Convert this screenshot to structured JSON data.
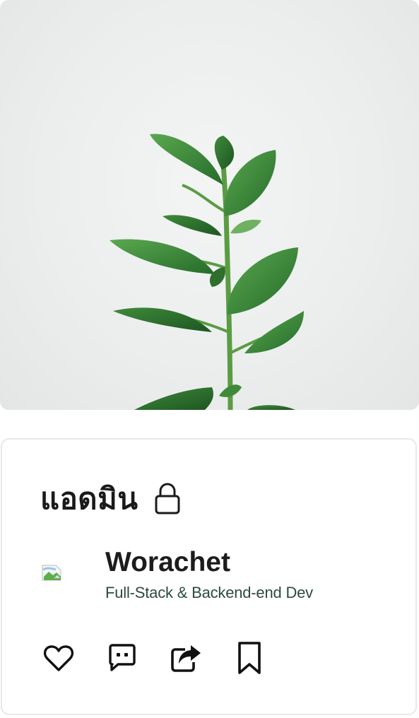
{
  "hero": {
    "image_icon": "plant-photo",
    "colors": {
      "background": "#eceeee",
      "leaf": "#3d8c3a",
      "stem": "#4f9a3f"
    }
  },
  "card": {
    "title": "แอดมิน",
    "title_icon": "lock-icon",
    "author": {
      "avatar_icon": "broken-image-icon",
      "name": "Worachet",
      "role": "Full-Stack & Backend-end Dev"
    },
    "actions": [
      {
        "icon": "heart-icon"
      },
      {
        "icon": "comment-icon"
      },
      {
        "icon": "share-icon"
      },
      {
        "icon": "bookmark-icon"
      }
    ]
  }
}
